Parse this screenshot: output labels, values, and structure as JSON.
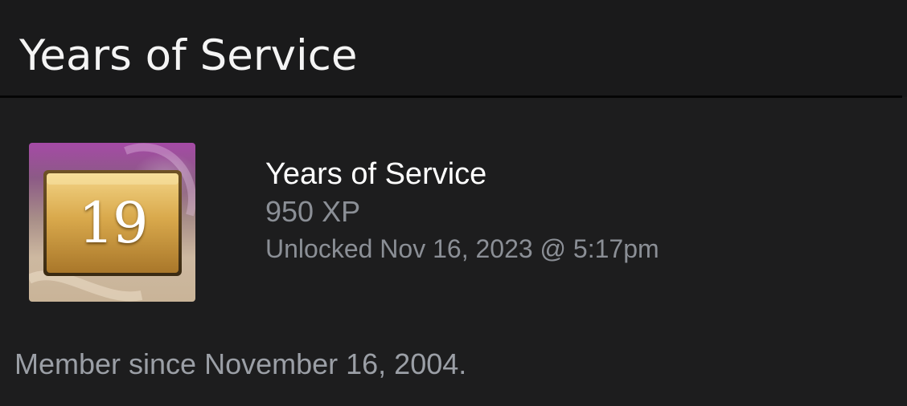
{
  "header": {
    "title": "Years of Service"
  },
  "badge": {
    "icon": "years-of-service-badge",
    "number": "19"
  },
  "achievement": {
    "name": "Years of Service",
    "xp": "950 XP",
    "unlocked": "Unlocked Nov 16, 2023 @ 5:17pm"
  },
  "member_since": "Member since November 16, 2004.",
  "colors": {
    "background": "#1d1d1e",
    "header_background": "#1a1a1b",
    "title_text": "#f4f4f4",
    "muted_text": "#8b8f96",
    "badge_gold": "#d6a84a",
    "badge_purple": "#a54aa6"
  }
}
